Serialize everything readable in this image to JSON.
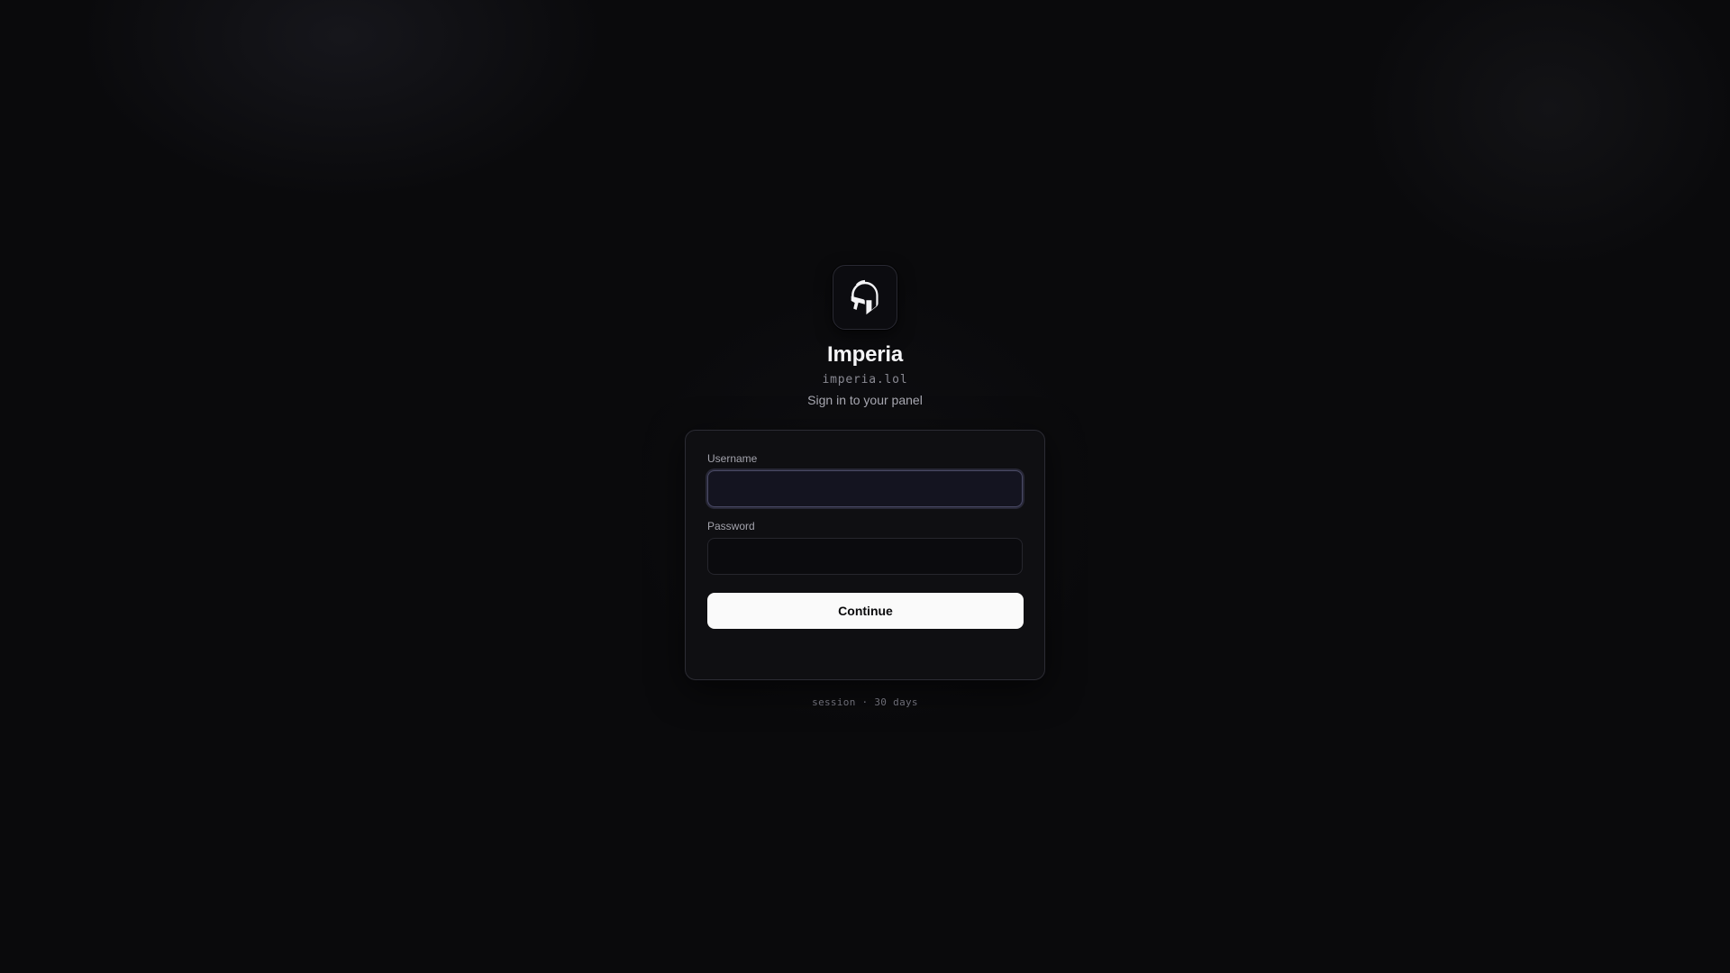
{
  "brand": {
    "logo_icon": "spartan-helmet-icon",
    "title": "Imperia",
    "domain": "imperia.lol",
    "subtitle": "Sign in to your panel"
  },
  "form": {
    "username": {
      "label": "Username",
      "value": "",
      "placeholder": "",
      "focused": true
    },
    "password": {
      "label": "Password",
      "value": "",
      "placeholder": ""
    },
    "submit_label": "Continue"
  },
  "footer": {
    "session_note": "session · 30 days"
  },
  "colors": {
    "background": "#0a0a0c",
    "card": "#0f0f12",
    "button": "#fafafa",
    "focus_ring": "#4a4a66"
  }
}
